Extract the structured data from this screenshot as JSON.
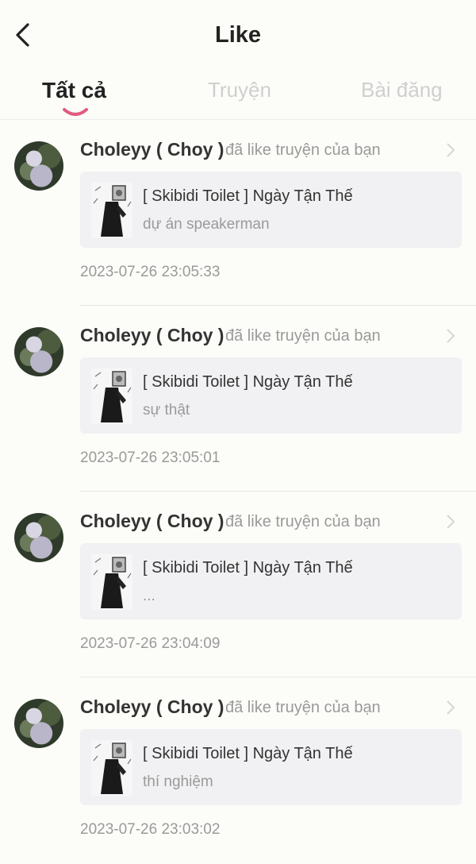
{
  "header": {
    "title": "Like",
    "back_icon": "chevron-left-icon"
  },
  "tabs": [
    {
      "label": "Tất cả",
      "active": true
    },
    {
      "label": "Truyện",
      "active": false
    },
    {
      "label": "Bài đăng",
      "active": false
    }
  ],
  "colors": {
    "accent": "#e05b7d",
    "inactive_tab": "#cfcfcf",
    "muted_text": "#9a9a9a"
  },
  "notifications": [
    {
      "user": "Choleyy ( Choy )",
      "action": "đã like truyện của bạn",
      "story_title": "[ Skibidi Toilet ] Ngày Tận Thế",
      "chapter": "dự án speakerman",
      "timestamp": "2023-07-26 23:05:33"
    },
    {
      "user": "Choleyy ( Choy )",
      "action": "đã like truyện của bạn",
      "story_title": "[ Skibidi Toilet ] Ngày Tận Thế",
      "chapter": "sự thật",
      "timestamp": "2023-07-26 23:05:01"
    },
    {
      "user": "Choleyy ( Choy )",
      "action": "đã like truyện của bạn",
      "story_title": "[ Skibidi Toilet ] Ngày Tận Thế",
      "chapter": "...",
      "timestamp": "2023-07-26 23:04:09"
    },
    {
      "user": "Choleyy ( Choy )",
      "action": "đã like truyện của bạn",
      "story_title": "[ Skibidi Toilet ] Ngày Tận Thế",
      "chapter": "thí nghiệm",
      "timestamp": "2023-07-26 23:03:02"
    }
  ]
}
